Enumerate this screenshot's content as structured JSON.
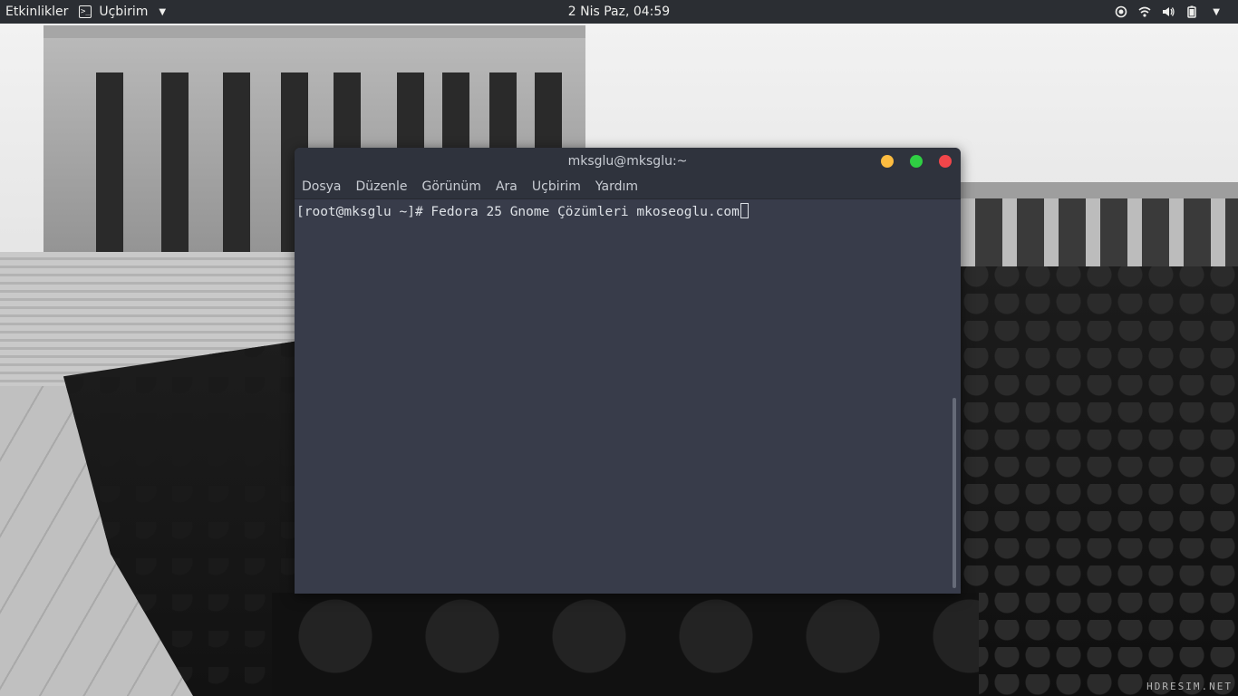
{
  "topbar": {
    "activities": "Etkinlikler",
    "app_name": "Uçbirim",
    "clock": "2 Nis Paz, 04:59"
  },
  "terminal": {
    "title": "mksglu@mksglu:~",
    "menu": [
      "Dosya",
      "Düzenle",
      "Görünüm",
      "Ara",
      "Uçbirim",
      "Yardım"
    ],
    "prompt": "[root@mksglu ~]# ",
    "command": "Fedora 25 Gnome Çözümleri mkoseoglu.com"
  },
  "desktop": {
    "watermark": "HDRESIM.NET"
  },
  "colors": {
    "topbar_bg": "#2b2e33",
    "terminal_bg": "#383c4a",
    "minimize": "#fdbc40",
    "maximize": "#2fcf43",
    "close": "#f1464a"
  }
}
